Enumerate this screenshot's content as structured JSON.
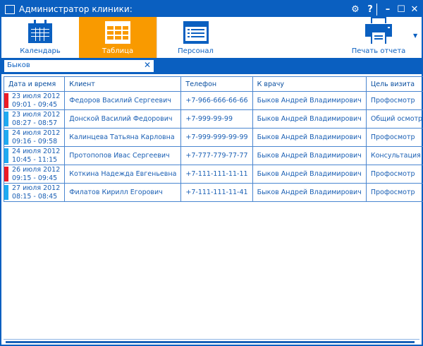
{
  "window": {
    "title": "Администратор клиники:"
  },
  "toolbar": {
    "calendar": "Календарь",
    "table": "Таблица",
    "staff": "Персонал",
    "print": "Печать отчета"
  },
  "search": {
    "value": "Быков"
  },
  "colors": {
    "accent": "#0a5fc0",
    "active": "#f99a00",
    "urgent": "#ee1c24",
    "normal": "#1eaaf1"
  },
  "table": {
    "headers": [
      "Дата и время",
      "Клиент",
      "Телефон",
      "К врачу",
      "Цель визита"
    ],
    "rows": [
      {
        "date": "23 июля 2012",
        "time": "09:01 - 09:45",
        "client": "Федоров Василий Сергеевич",
        "phone": "+7-966-666-66-66",
        "doctor": "Быков Андрей Владимирович",
        "purpose": "Профосмотр",
        "status": "urgent"
      },
      {
        "date": "23 июля 2012",
        "time": "08:27 - 08:57",
        "client": "Донской Василий Федорович",
        "phone": "+7-999-99-99",
        "doctor": "Быков Андрей Владимирович",
        "purpose": "Общий осмотр",
        "status": "normal"
      },
      {
        "date": "24 июля 2012",
        "time": "09:16 - 09:58",
        "client": "Калинцева Татьяна Карловна",
        "phone": "+7-999-999-99-99",
        "doctor": "Быков Андрей Владимирович",
        "purpose": "Профосмотр",
        "status": "normal"
      },
      {
        "date": "24 июля 2012",
        "time": "10:45 - 11:15",
        "client": "Протопопов Ивас Сергеевич",
        "phone": "+7-777-779-77-77",
        "doctor": "Быков Андрей Владимирович",
        "purpose": "Консультация",
        "status": "normal"
      },
      {
        "date": "26 июля 2012",
        "time": "09:15 - 09:45",
        "client": "Коткина Надежда Евгеньевна",
        "phone": "+7-111-111-11-11",
        "doctor": "Быков Андрей Владимирович",
        "purpose": "Профосмотр",
        "status": "urgent"
      },
      {
        "date": "27 июля 2012",
        "time": "08:15 - 08:45",
        "client": "Филатов Кирилл Егорович",
        "phone": "+7-111-111-11-41",
        "doctor": "Быков Андрей Владимирович",
        "purpose": "Профосмотр",
        "status": "normal"
      }
    ]
  }
}
